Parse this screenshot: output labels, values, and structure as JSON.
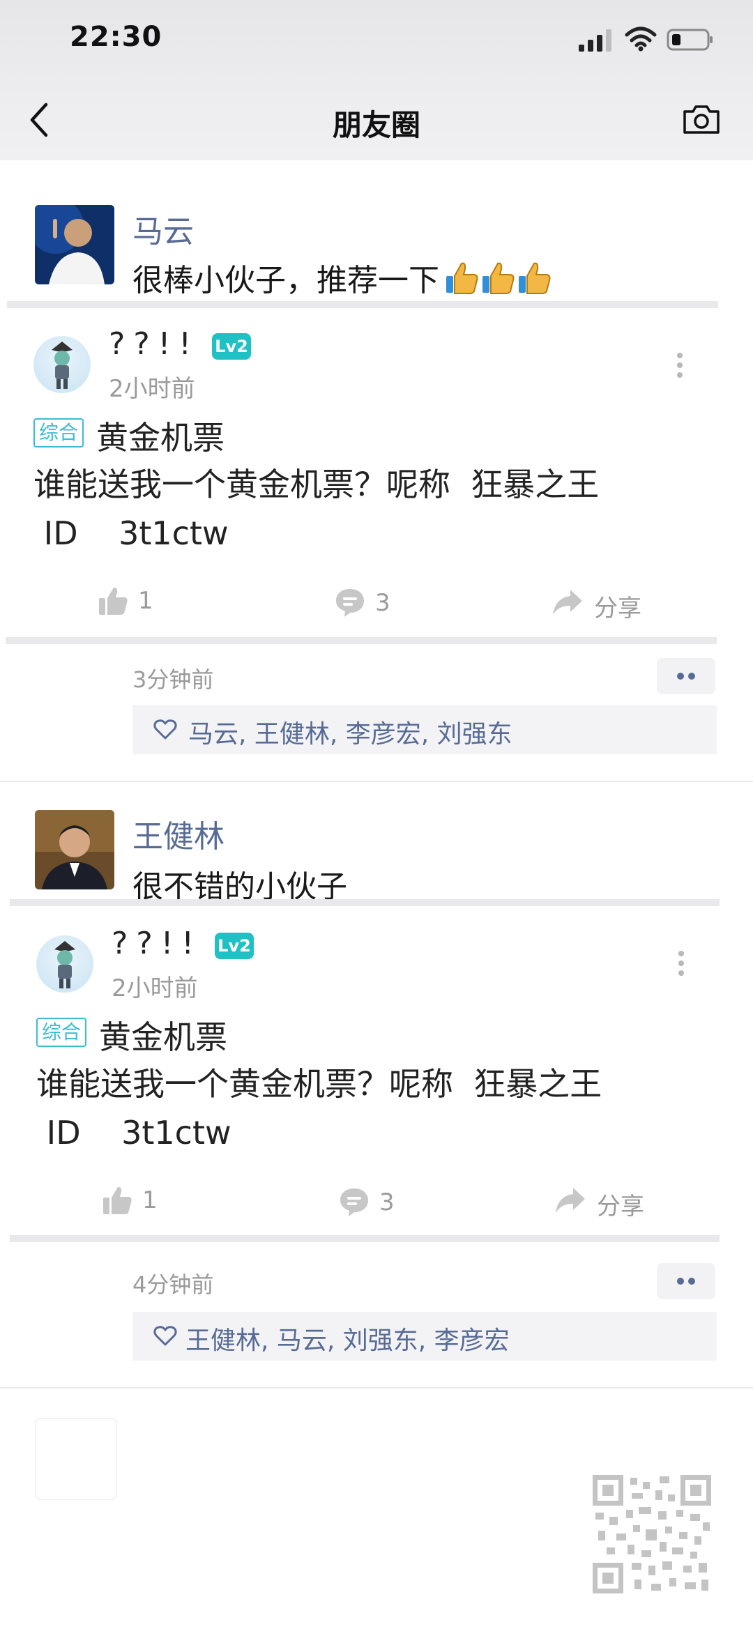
{
  "status": {
    "time": "22:30"
  },
  "nav": {
    "title": "朋友圈"
  },
  "posts": [
    {
      "comment": {
        "author": "马云",
        "text": "很棒小伙子，推荐一下"
      },
      "post": {
        "username": "??!!",
        "level": "Lv2",
        "time": "2小时前",
        "tag": "综合",
        "title": "黄金机票",
        "body": "谁能送我一个黄金机票？呢称  狂暴之王\n ID    3t1ctw",
        "likes": "1",
        "comments": "3",
        "share": "分享"
      },
      "moment": {
        "time": "3分钟前",
        "likes": "马云, 王健林, 李彦宏, 刘强东"
      }
    },
    {
      "comment": {
        "author": "王健林",
        "text": "很不错的小伙子"
      },
      "post": {
        "username": "??!!",
        "level": "Lv2",
        "time": "2小时前",
        "tag": "综合",
        "title": "黄金机票",
        "body": "谁能送我一个黄金机票？呢称  狂暴之王\n ID    3t1ctw",
        "likes": "1",
        "comments": "3",
        "share": "分享"
      },
      "moment": {
        "time": "4分钟前",
        "likes": "王健林, 马云, 刘强东, 李彦宏"
      }
    }
  ],
  "icons": [
    "signal-icon",
    "wifi-icon",
    "battery-icon",
    "back-icon",
    "camera-icon",
    "thumbs-up-emoji",
    "menu-dots-icon",
    "like-icon",
    "comment-icon",
    "share-icon",
    "heart-icon",
    "qr-code"
  ]
}
